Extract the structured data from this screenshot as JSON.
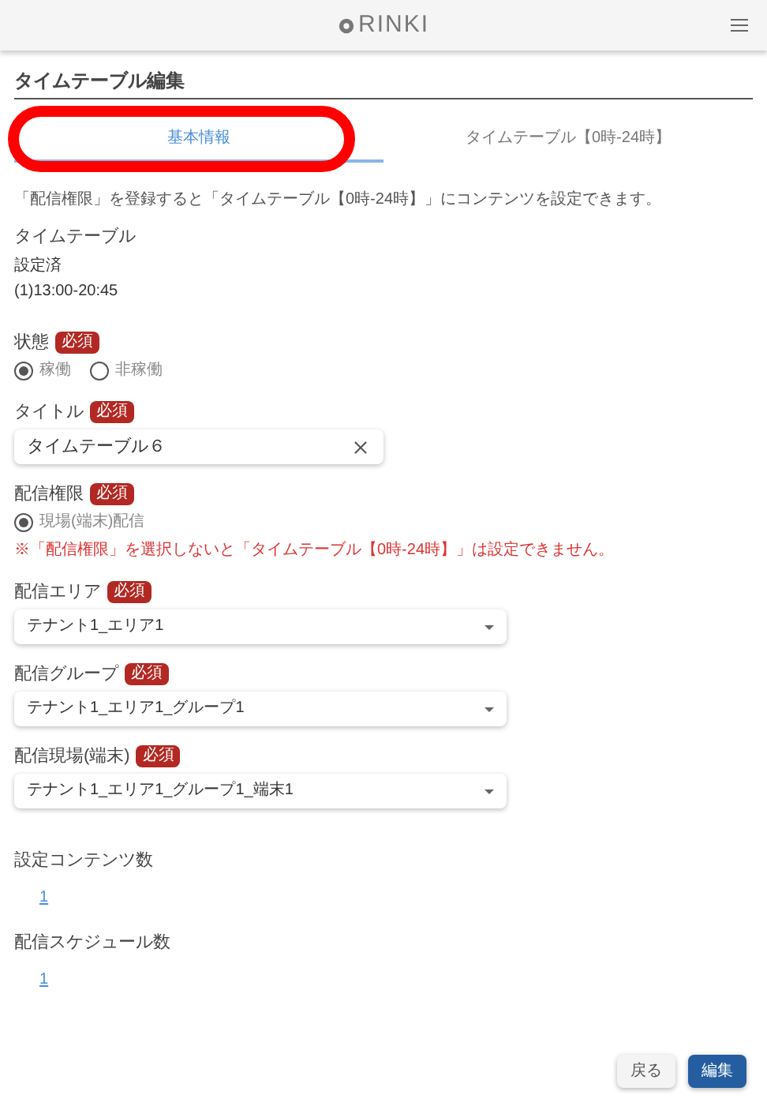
{
  "header": {
    "logo": "RINKI"
  },
  "page_title": "タイムテーブル編集",
  "tabs": [
    {
      "label": "基本情報",
      "selected": true
    },
    {
      "label": "タイムテーブル【0時-24時】",
      "selected": false
    }
  ],
  "note": "「配信権限」を登録すると「タイムテーブル【0時-24時】」にコンテンツを設定できます。",
  "timetable": {
    "label": "タイムテーブル",
    "status": "設定済",
    "slots": [
      "(1)13:00-20:45"
    ]
  },
  "fields": [
    {
      "kind": "radio",
      "label": "状態",
      "badge": "必須",
      "options": [
        {
          "label": "稼働",
          "selected": true
        },
        {
          "label": "非稼働",
          "selected": false
        }
      ]
    },
    {
      "kind": "text",
      "label": "タイトル",
      "badge": "必須",
      "value": "タイムテーブル６"
    },
    {
      "kind": "radio",
      "label": "配信権限",
      "badge": "必須",
      "options": [
        {
          "label": "現場(端末)配信",
          "selected": true
        }
      ],
      "warning": "※「配信権限」を選択しないと「タイムテーブル【0時-24時】」は設定できません。"
    },
    {
      "kind": "select",
      "label": "配信エリア",
      "badge": "必須",
      "value": "テナント1_エリア1"
    },
    {
      "kind": "select",
      "label": "配信グループ",
      "badge": "必須",
      "value": "テナント1_エリア1_グループ1"
    },
    {
      "kind": "select",
      "label": "配信現場(端末)",
      "badge": "必須",
      "value": "テナント1_エリア1_グループ1_端末1"
    }
  ],
  "counts": [
    {
      "label": "設定コンテンツ数",
      "value": "1"
    },
    {
      "label": "配信スケジュール数",
      "value": "1"
    }
  ],
  "buttons": [
    {
      "label": "戻る",
      "kind": "secondary"
    },
    {
      "label": "編集",
      "kind": "primary"
    }
  ]
}
